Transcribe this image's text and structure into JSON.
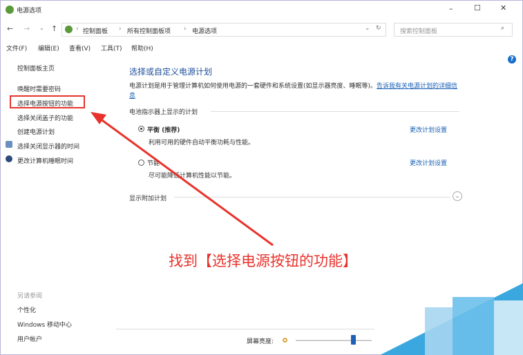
{
  "window": {
    "title": "电源选项",
    "minimize": "–",
    "maximize": "☐",
    "close": "✕"
  },
  "address": {
    "crumbs": [
      "控制面板",
      "所有控制面板项",
      "电源选项"
    ],
    "search_placeholder": "搜索控制面板"
  },
  "menu": [
    "文件(F)",
    "编辑(E)",
    "查看(V)",
    "工具(T)",
    "帮助(H)"
  ],
  "sidebar": {
    "items": [
      "控制面板主页",
      "唤醒时需要密码",
      "选择电源按钮的功能",
      "选择关闭盖子的功能",
      "创建电源计划",
      "选择关闭显示器的时间",
      "更改计算机睡眠时间"
    ],
    "see_also": "另请参阅",
    "see_also_items": [
      "个性化",
      "Windows 移动中心",
      "用户帐户"
    ]
  },
  "main": {
    "title": "选择或自定义电源计划",
    "desc": "电源计划是用于管理计算机如何使用电源的一套硬件和系统设置(如显示器亮度、睡眠等)。",
    "desc_link": "告诉我有关电源计划的详细信息",
    "section": "电池指示器上显示的计划",
    "plans": [
      {
        "name": "平衡 (推荐)",
        "desc": "利用可用的硬件自动平衡功耗与性能。",
        "link": "更改计划设置",
        "selected": true
      },
      {
        "name": "节能",
        "desc": "尽可能降低计算机性能以节能。",
        "link": "更改计划设置",
        "selected": false
      }
    ],
    "more": "显示附加计划"
  },
  "brightness": {
    "label": "屏幕亮度:",
    "value": 0.75
  },
  "annotation": {
    "text": "找到【选择电源按钮的功能】",
    "color": "#e8322b"
  }
}
